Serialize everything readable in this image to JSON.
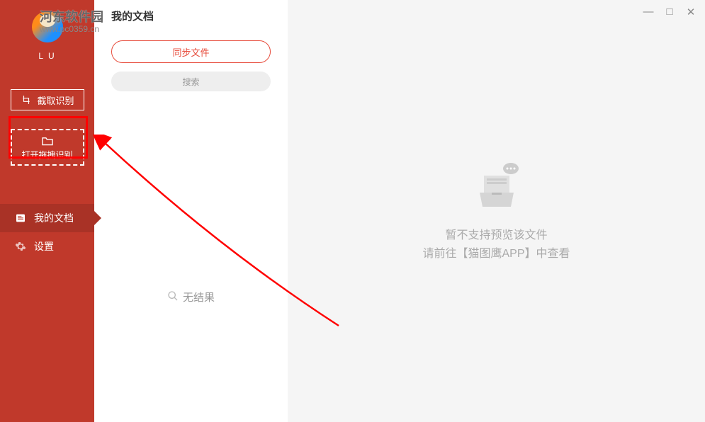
{
  "watermark": {
    "top": "河东软件园",
    "sub": "www.pc0359.cn"
  },
  "sidebar": {
    "profile_name": "L U",
    "crop_button": "截取识别",
    "open_drag_button": "打开拖拽识别",
    "nav_docs": "我的文档",
    "nav_settings": "设置"
  },
  "left_panel": {
    "title": "我的文档",
    "sync_button": "同步文件",
    "search_button": "搜索",
    "no_result": "无结果"
  },
  "right_panel": {
    "line1": "暂不支持预览该文件",
    "line2": "请前往【猫图鹰APP】中查看"
  },
  "window": {
    "min": "—",
    "max": "□",
    "close": "✕"
  }
}
